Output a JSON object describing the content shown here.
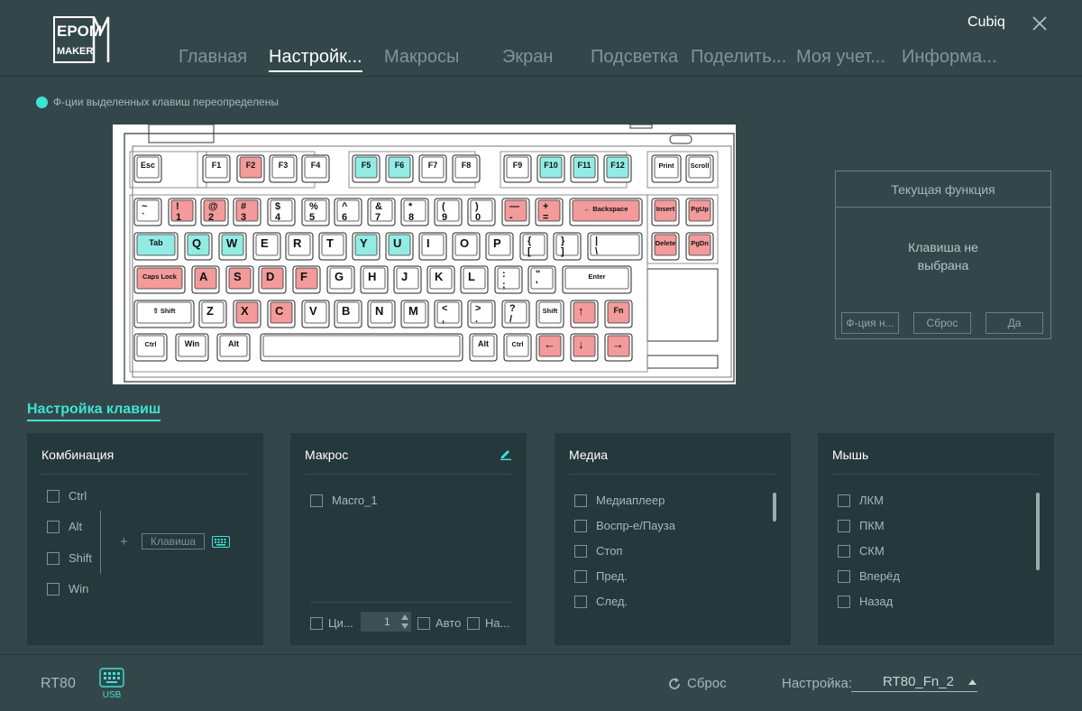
{
  "header": {
    "user": "Cubiq",
    "logo_text": [
      "EPOM",
      "MAKER"
    ]
  },
  "nav": {
    "tabs": [
      {
        "label": "Главная"
      },
      {
        "label": "Настройк..."
      },
      {
        "label": "Макросы"
      },
      {
        "label": "Экран"
      },
      {
        "label": "Подсветка"
      },
      {
        "label": "Поделить..."
      },
      {
        "label": "Моя учет..."
      },
      {
        "label": "Информа..."
      }
    ],
    "active_index": 1
  },
  "legend": {
    "text": "Ф-ции выделенных клавиш переопределены",
    "color": "#3ee3d3"
  },
  "keyboard": {
    "colors": {
      "highlight_blue": "#92ece4",
      "highlight_red": "#f39a9a",
      "key": "#ffffff"
    },
    "row_fn": [
      {
        "t": "Esc",
        "c": "n"
      },
      {
        "t": "F1",
        "c": "n"
      },
      {
        "t": "F2",
        "c": "r"
      },
      {
        "t": "F3",
        "c": "n"
      },
      {
        "t": "F4",
        "c": "n"
      },
      {
        "t": "F5",
        "c": "b"
      },
      {
        "t": "F6",
        "c": "b"
      },
      {
        "t": "F7",
        "c": "n"
      },
      {
        "t": "F8",
        "c": "n"
      },
      {
        "t": "F9",
        "c": "n"
      },
      {
        "t": "F10",
        "c": "b"
      },
      {
        "t": "F11",
        "c": "b"
      },
      {
        "t": "F12",
        "c": "b"
      },
      {
        "t": "Print",
        "c": "n"
      },
      {
        "t": "Scroll",
        "c": "n"
      }
    ],
    "row_num": [
      {
        "t": "~",
        "b": "`",
        "c": "n"
      },
      {
        "t": "!",
        "b": "1",
        "c": "r"
      },
      {
        "t": "@",
        "b": "2",
        "c": "r"
      },
      {
        "t": "#",
        "b": "3",
        "c": "r"
      },
      {
        "t": "$",
        "b": "4",
        "c": "n"
      },
      {
        "t": "%",
        "b": "5",
        "c": "n"
      },
      {
        "t": "^",
        "b": "6",
        "c": "n"
      },
      {
        "t": "&",
        "b": "7",
        "c": "n"
      },
      {
        "t": "*",
        "b": "8",
        "c": "n"
      },
      {
        "t": "(",
        "b": "9",
        "c": "n"
      },
      {
        "t": ")",
        "b": "0",
        "c": "n"
      },
      {
        "t": "—",
        "b": "-",
        "c": "r"
      },
      {
        "t": "+",
        "b": "=",
        "c": "r"
      },
      {
        "t": "← Backspace",
        "c": "r"
      },
      {
        "t": "Insert",
        "c": "r"
      },
      {
        "t": "PgUp",
        "c": "r"
      }
    ],
    "row_q": [
      {
        "t": "Tab",
        "c": "b"
      },
      {
        "t": "Q",
        "c": "b"
      },
      {
        "t": "W",
        "c": "b"
      },
      {
        "t": "E",
        "c": "n"
      },
      {
        "t": "R",
        "c": "n"
      },
      {
        "t": "T",
        "c": "n"
      },
      {
        "t": "Y",
        "c": "b"
      },
      {
        "t": "U",
        "c": "b"
      },
      {
        "t": "I",
        "c": "n"
      },
      {
        "t": "O",
        "c": "n"
      },
      {
        "t": "P",
        "c": "n"
      },
      {
        "t": "{",
        "b": "[",
        "c": "n"
      },
      {
        "t": "}",
        "b": "]",
        "c": "n"
      },
      {
        "t": "|",
        "b": "\\",
        "c": "n"
      },
      {
        "t": "Delete",
        "c": "r"
      },
      {
        "t": "PgDn",
        "c": "r"
      }
    ],
    "row_a": [
      {
        "t": "Caps Lock",
        "c": "r"
      },
      {
        "t": "A",
        "c": "r"
      },
      {
        "t": "S",
        "c": "r"
      },
      {
        "t": "D",
        "c": "r"
      },
      {
        "t": "F",
        "c": "r"
      },
      {
        "t": "G",
        "c": "n"
      },
      {
        "t": "H",
        "c": "n"
      },
      {
        "t": "J",
        "c": "n"
      },
      {
        "t": "K",
        "c": "n"
      },
      {
        "t": "L",
        "c": "n"
      },
      {
        "t": ":",
        "b": ";",
        "c": "n"
      },
      {
        "t": "\"",
        "b": "'",
        "c": "n"
      },
      {
        "t": "Enter",
        "c": "n"
      }
    ],
    "row_z": [
      {
        "t": "⇧ Shift",
        "c": "n"
      },
      {
        "t": "Z",
        "c": "n"
      },
      {
        "t": "X",
        "c": "r"
      },
      {
        "t": "C",
        "c": "r"
      },
      {
        "t": "V",
        "c": "n"
      },
      {
        "t": "B",
        "c": "n"
      },
      {
        "t": "N",
        "c": "n"
      },
      {
        "t": "M",
        "c": "n"
      },
      {
        "t": "<",
        "b": ",",
        "c": "n"
      },
      {
        "t": ">",
        "b": ".",
        "c": "n"
      },
      {
        "t": "?",
        "b": "/",
        "c": "n"
      },
      {
        "t": "Shift",
        "c": "n"
      },
      {
        "t": "↑",
        "c": "r"
      },
      {
        "t": "Fn",
        "c": "r"
      }
    ],
    "row_bottom": [
      {
        "t": "Ctrl",
        "c": "n"
      },
      {
        "t": "Win",
        "c": "n"
      },
      {
        "t": "Alt",
        "c": "n"
      },
      {
        "t": "",
        "c": "n"
      },
      {
        "t": "Alt",
        "c": "n"
      },
      {
        "t": "Ctrl",
        "c": "n"
      },
      {
        "t": "←",
        "c": "r"
      },
      {
        "t": "↓",
        "c": "r"
      },
      {
        "t": "→",
        "c": "r"
      }
    ]
  },
  "current_function": {
    "title": "Текущая функция",
    "body_line1": "Клавиша не",
    "body_line2": "выбрана",
    "btn_fn": "Ф-ция н...",
    "btn_reset": "Сброс",
    "btn_ok": "Да"
  },
  "key_settings": {
    "title": "Настройка клавиш",
    "combo": {
      "title": "Комбинация",
      "mods": [
        "Ctrl",
        "Alt",
        "Shift",
        "Win"
      ],
      "plus": "+",
      "key_placeholder": "Клавиша"
    },
    "macro": {
      "title": "Макрос",
      "items": [
        "Macro_1"
      ],
      "cycle_label": "Ци...",
      "count": "1",
      "auto_label": "Авто",
      "na_label": "На..."
    },
    "media": {
      "title": "Медиа",
      "items": [
        "Медиаплеер",
        "Воспр-е/Пауза",
        "Стоп",
        "Пред.",
        "След."
      ]
    },
    "mouse": {
      "title": "Мышь",
      "items": [
        "ЛКМ",
        "ПКМ",
        "СКМ",
        "Вперёд",
        "Назад"
      ]
    }
  },
  "footer": {
    "device": "RT80",
    "usb_label": "USB",
    "reset_label": "Сброс",
    "profile_label": "Настройка:",
    "profile_value": "RT80_Fn_2"
  }
}
